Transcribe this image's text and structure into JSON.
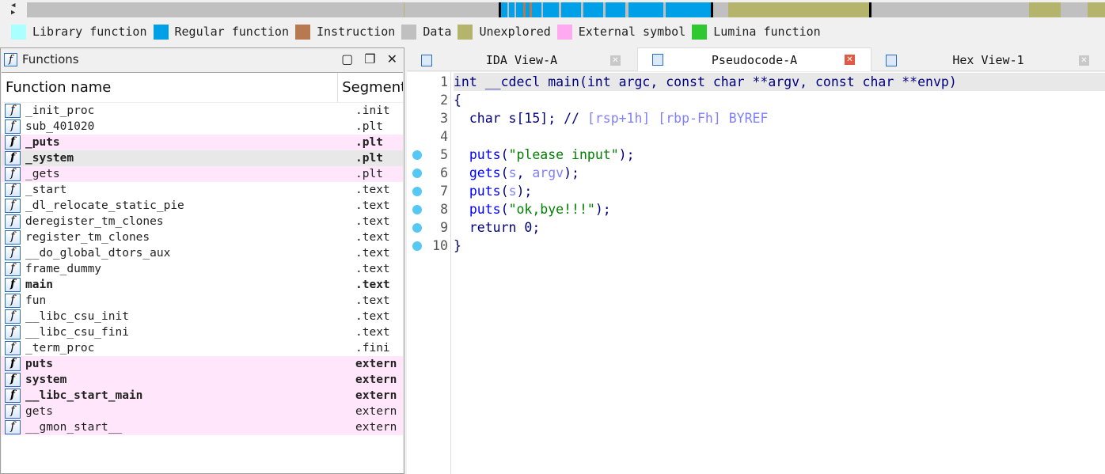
{
  "legend": [
    {
      "label": "Library function",
      "color": "#aaffff"
    },
    {
      "label": "Regular function",
      "color": "#00a0e8"
    },
    {
      "label": "Instruction",
      "color": "#b87850"
    },
    {
      "label": "Data",
      "color": "#c0c0c0"
    },
    {
      "label": "Unexplored",
      "color": "#b4b46c"
    },
    {
      "label": "External symbol",
      "color": "#ffaaf0"
    },
    {
      "label": "Lumina function",
      "color": "#30c830"
    }
  ],
  "functions_panel": {
    "title": "Functions",
    "columns": [
      "Function name",
      "Segment"
    ],
    "rows": [
      {
        "name": "_init_proc",
        "segment": ".init",
        "bold": false,
        "style": ""
      },
      {
        "name": "sub_401020",
        "segment": ".plt",
        "bold": false,
        "style": ""
      },
      {
        "name": "_puts",
        "segment": ".plt",
        "bold": true,
        "style": "pink"
      },
      {
        "name": "_system",
        "segment": ".plt",
        "bold": true,
        "style": "sel"
      },
      {
        "name": "_gets",
        "segment": ".plt",
        "bold": false,
        "style": "pink"
      },
      {
        "name": "_start",
        "segment": ".text",
        "bold": false,
        "style": ""
      },
      {
        "name": "_dl_relocate_static_pie",
        "segment": ".text",
        "bold": false,
        "style": ""
      },
      {
        "name": "deregister_tm_clones",
        "segment": ".text",
        "bold": false,
        "style": ""
      },
      {
        "name": "register_tm_clones",
        "segment": ".text",
        "bold": false,
        "style": ""
      },
      {
        "name": "__do_global_dtors_aux",
        "segment": ".text",
        "bold": false,
        "style": ""
      },
      {
        "name": "frame_dummy",
        "segment": ".text",
        "bold": false,
        "style": ""
      },
      {
        "name": "main",
        "segment": ".text",
        "bold": true,
        "style": ""
      },
      {
        "name": "fun",
        "segment": ".text",
        "bold": false,
        "style": ""
      },
      {
        "name": "__libc_csu_init",
        "segment": ".text",
        "bold": false,
        "style": ""
      },
      {
        "name": "__libc_csu_fini",
        "segment": ".text",
        "bold": false,
        "style": ""
      },
      {
        "name": "_term_proc",
        "segment": ".fini",
        "bold": false,
        "style": ""
      },
      {
        "name": "puts",
        "segment": "extern",
        "bold": true,
        "style": "pink"
      },
      {
        "name": "system",
        "segment": "extern",
        "bold": true,
        "style": "pink"
      },
      {
        "name": "__libc_start_main",
        "segment": "extern",
        "bold": true,
        "style": "pink"
      },
      {
        "name": "gets",
        "segment": "extern",
        "bold": false,
        "style": "pink"
      },
      {
        "name": "__gmon_start__",
        "segment": "extern",
        "bold": false,
        "style": "pink"
      }
    ]
  },
  "tabs": [
    {
      "label": "IDA View-A",
      "active": false
    },
    {
      "label": "Pseudocode-A",
      "active": true
    },
    {
      "label": "Hex View-1",
      "active": false
    }
  ],
  "code": [
    {
      "n": "1",
      "dot": false,
      "hl": true,
      "t": [
        [
          "p",
          "int __cdecl main(int argc, const char **argv, const char **envp)"
        ]
      ]
    },
    {
      "n": "2",
      "dot": false,
      "t": [
        [
          "p",
          "{"
        ]
      ]
    },
    {
      "n": "3",
      "dot": false,
      "t": [
        [
          "p",
          "  char s[15]; // "
        ],
        [
          "cmt",
          "[rsp+1h] [rbp-Fh] BYREF"
        ]
      ]
    },
    {
      "n": "4",
      "dot": false,
      "t": []
    },
    {
      "n": "5",
      "dot": true,
      "t": [
        [
          "p",
          "  "
        ],
        [
          "fn",
          "puts"
        ],
        [
          "p",
          "("
        ],
        [
          "str",
          "\"please input\""
        ],
        [
          "p",
          ");"
        ]
      ]
    },
    {
      "n": "6",
      "dot": true,
      "t": [
        [
          "p",
          "  "
        ],
        [
          "fn",
          "gets"
        ],
        [
          "p",
          "("
        ],
        [
          "var",
          "s"
        ],
        [
          "p",
          ", "
        ],
        [
          "var",
          "argv"
        ],
        [
          "p",
          ");"
        ]
      ]
    },
    {
      "n": "7",
      "dot": true,
      "t": [
        [
          "p",
          "  "
        ],
        [
          "fn",
          "puts"
        ],
        [
          "p",
          "("
        ],
        [
          "var",
          "s"
        ],
        [
          "p",
          ");"
        ]
      ]
    },
    {
      "n": "8",
      "dot": true,
      "t": [
        [
          "p",
          "  "
        ],
        [
          "fn",
          "puts"
        ],
        [
          "p",
          "("
        ],
        [
          "str",
          "\"ok,bye!!!\""
        ],
        [
          "p",
          ");"
        ]
      ]
    },
    {
      "n": "9",
      "dot": true,
      "t": [
        [
          "p",
          "  return 0;"
        ]
      ]
    },
    {
      "n": "10",
      "dot": true,
      "t": [
        [
          "p",
          "}"
        ]
      ]
    }
  ]
}
